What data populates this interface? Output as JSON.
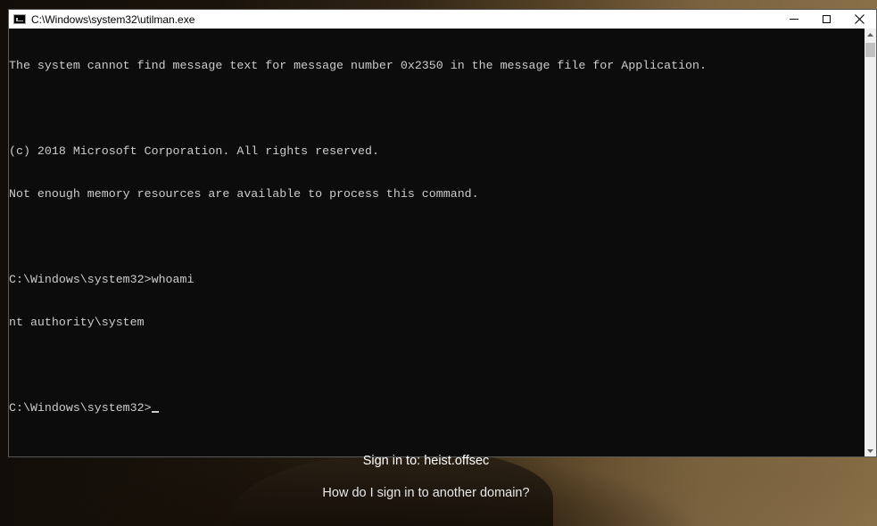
{
  "window": {
    "title": "C:\\Windows\\system32\\utilman.exe",
    "controls": {
      "minimize": "minimize",
      "maximize": "maximize",
      "close": "close"
    }
  },
  "console": {
    "lines": [
      "The system cannot find message text for message number 0x2350 in the message file for Application.",
      "",
      "(c) 2018 Microsoft Corporation. All rights reserved.",
      "Not enough memory resources are available to process this command.",
      "",
      "C:\\Windows\\system32>whoami",
      "nt authority\\system",
      ""
    ],
    "prompt": "C:\\Windows\\system32>"
  },
  "login": {
    "sign_in_domain": "Sign in to: heist.offsec",
    "another_domain_link": "How do I sign in to another domain?"
  },
  "colors": {
    "console_bg": "#0c0c0c",
    "console_text": "#cccccc",
    "titlebar_bg": "#ffffff"
  }
}
